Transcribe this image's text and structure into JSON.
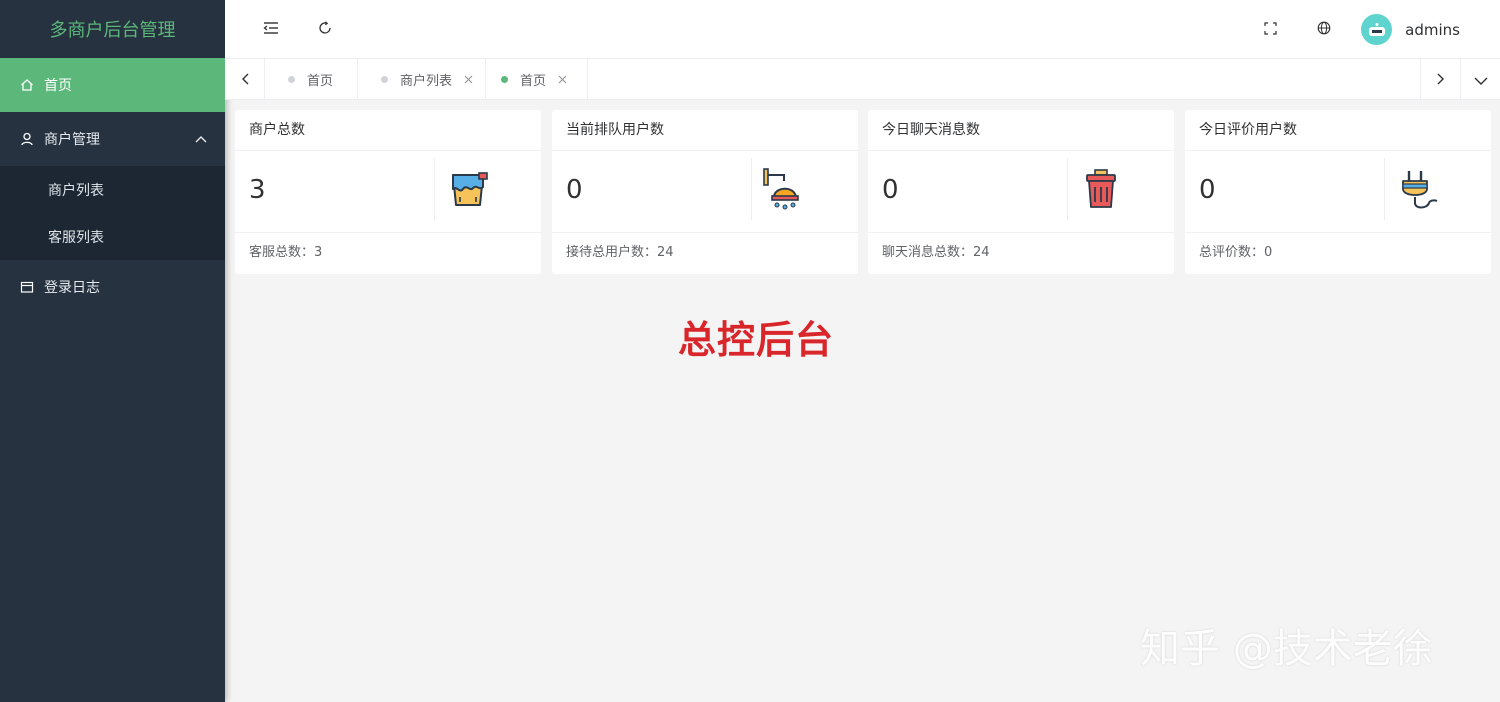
{
  "sidebar": {
    "title": "多商户后台管理",
    "items": [
      {
        "label": "首页",
        "icon": "home-icon"
      },
      {
        "label": "商户管理",
        "icon": "user-icon",
        "expanded": true,
        "children": [
          {
            "label": "商户列表"
          },
          {
            "label": "客服列表"
          }
        ]
      },
      {
        "label": "登录日志",
        "icon": "calendar-icon"
      }
    ]
  },
  "header": {
    "username": "admins"
  },
  "tabs": [
    {
      "label": "首页",
      "closable": false,
      "active": false
    },
    {
      "label": "商户列表",
      "closable": true,
      "active": false
    },
    {
      "label": "首页",
      "closable": true,
      "active": true
    }
  ],
  "cards": [
    {
      "title": "商户总数",
      "value": "3",
      "footer": "客服总数：3",
      "icon": "paint-bucket-icon"
    },
    {
      "title": "当前排队用户数",
      "value": "0",
      "footer": "接待总用户数：24",
      "icon": "shower-icon"
    },
    {
      "title": "今日聊天消息数",
      "value": "0",
      "footer": "聊天消息总数：24",
      "icon": "trash-can-icon"
    },
    {
      "title": "今日评价用户数",
      "value": "0",
      "footer": "总评价数：0",
      "icon": "plug-icon"
    }
  ],
  "headline": "总控后台",
  "watermark": "知乎 @技术老徐",
  "colors": {
    "accent": "#5cb87a",
    "sidebar": "#263240",
    "headline": "#d9262a"
  }
}
